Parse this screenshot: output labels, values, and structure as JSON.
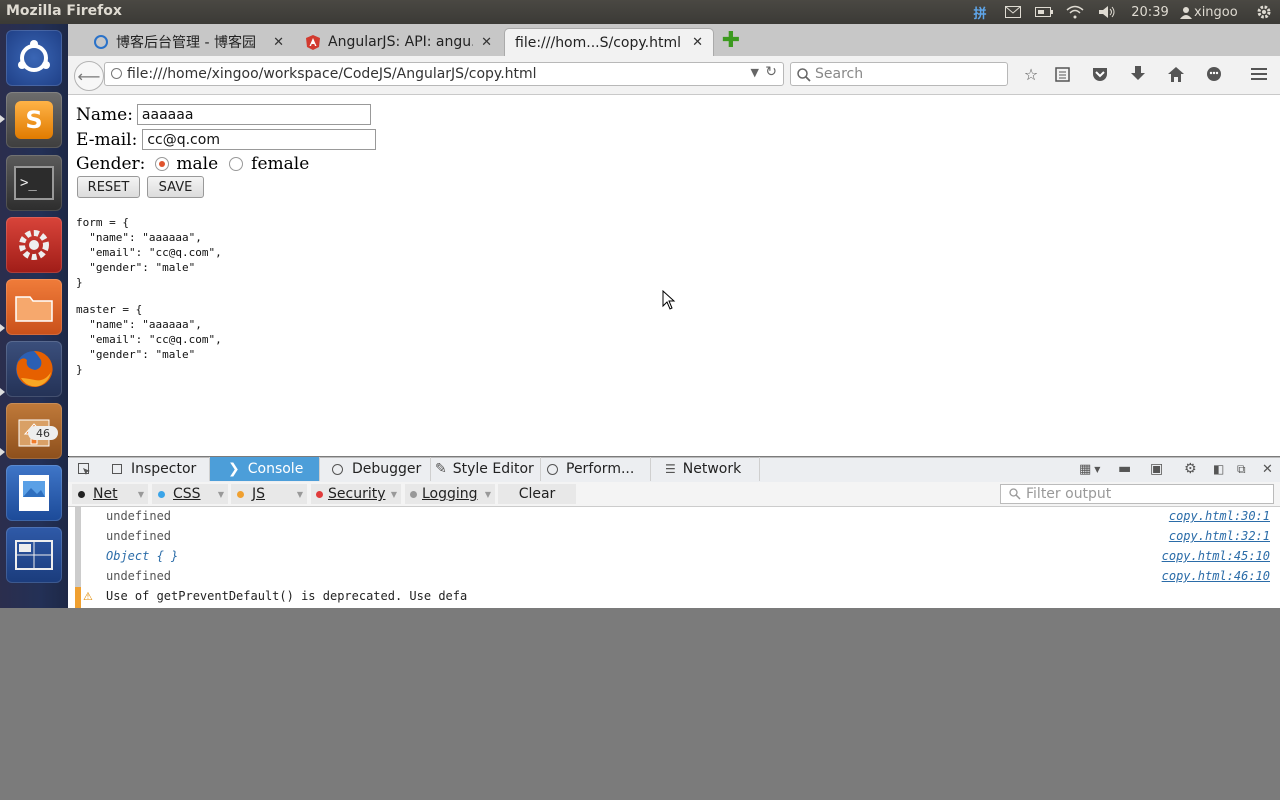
{
  "top_panel": {
    "app_title": "Mozilla Firefox",
    "time": "20:39",
    "user": "xingoo",
    "input_method": "拼"
  },
  "launcher": {
    "items": [
      "dash",
      "sublime-text",
      "terminal",
      "system-settings",
      "files",
      "firefox",
      "software-updater",
      "image-viewer",
      "workspace-switcher"
    ],
    "updater_badge": "46"
  },
  "tabs": [
    {
      "label": "博客后台管理 - 博客园"
    },
    {
      "label": "AngularJS: API: angu..."
    },
    {
      "label": "file:///hom...S/copy.html"
    }
  ],
  "navbar": {
    "url": "file:///home/xingoo/workspace/CodeJS/AngularJS/copy.html",
    "search_placeholder": "Search"
  },
  "page": {
    "name_label": "Name:",
    "name_value": "aaaaaa",
    "email_label": "E-mail:",
    "email_value": "cc@q.com",
    "gender_label": "Gender:",
    "gender_male": "male",
    "gender_female": "female",
    "reset_label": "RESET",
    "save_label": "SAVE",
    "form_dump": "form = {\n  \"name\": \"aaaaaa\",\n  \"email\": \"cc@q.com\",\n  \"gender\": \"male\"\n}",
    "master_dump": "master = {\n  \"name\": \"aaaaaa\",\n  \"email\": \"cc@q.com\",\n  \"gender\": \"male\"\n}"
  },
  "devtools": {
    "tabs": [
      "Inspector",
      "Console",
      "Debugger",
      "Style Editor",
      "Perform...",
      "Network"
    ],
    "filters": [
      "Net",
      "CSS",
      "JS",
      "Security",
      "Logging"
    ],
    "clear_label": "Clear",
    "filter_placeholder": "Filter output",
    "console_rows": [
      {
        "text": "undefined",
        "source": "copy.html:30:1"
      },
      {
        "text": "undefined",
        "source": "copy.html:32:1"
      },
      {
        "text": "Object {  }",
        "source": "copy.html:45:10"
      },
      {
        "text": "undefined",
        "source": "copy.html:46:10"
      },
      {
        "text": "Use of getPreventDefault() is deprecated.  Use defa",
        "source": ""
      }
    ]
  },
  "colors": {
    "accent": "#4c9ed9",
    "launcher_bg": "#233056",
    "panel_bg": "#3b3a36",
    "desktop_bg": "#7b7b7b"
  }
}
